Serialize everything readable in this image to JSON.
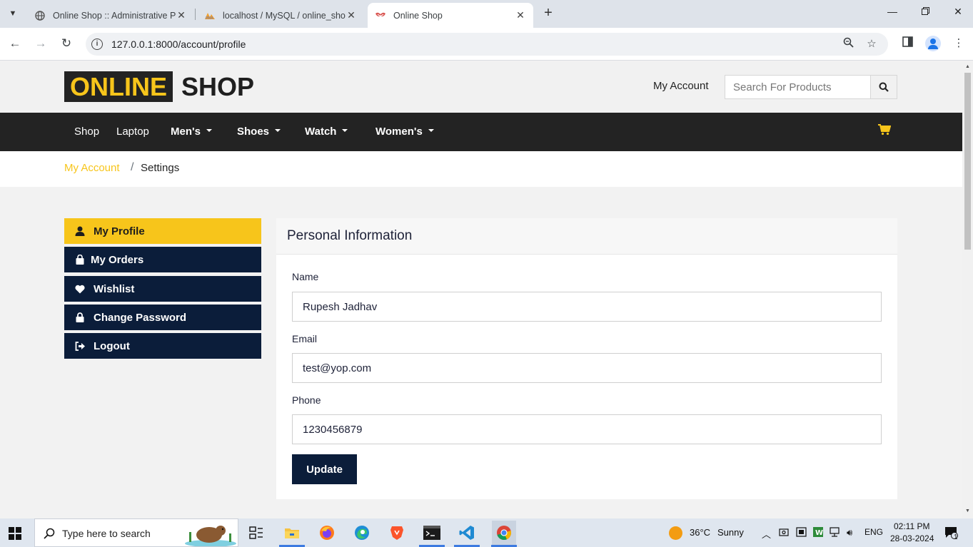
{
  "browser": {
    "tabs": [
      {
        "title": "Online Shop :: Administrative Pa",
        "active": false
      },
      {
        "title": "localhost / MySQL / online_shop",
        "active": false
      },
      {
        "title": "Online Shop",
        "active": true
      }
    ],
    "url": "127.0.0.1:8000/account/profile",
    "new_tab_label": "+",
    "tab_close": "✕"
  },
  "site": {
    "logo_part1": "ONLINE",
    "logo_part2": "SHOP",
    "my_account": "My Account",
    "search_placeholder": "Search For Products",
    "nav": {
      "items": [
        "Shop",
        "Laptop",
        "Men's",
        "Shoes",
        "Watch",
        "Women's"
      ]
    },
    "breadcrumb": {
      "link": "My Account",
      "separator": "/",
      "current": "Settings"
    },
    "sidebar": {
      "items": [
        {
          "label": "My Profile",
          "icon": "user-icon",
          "active": true
        },
        {
          "label": "My Orders",
          "icon": "shopping-bag-icon",
          "active": false
        },
        {
          "label": "Wishlist",
          "icon": "heart-icon",
          "active": false
        },
        {
          "label": "Change Password",
          "icon": "lock-icon",
          "active": false
        },
        {
          "label": "Logout",
          "icon": "sign-out-icon",
          "active": false
        }
      ]
    },
    "profile": {
      "title": "Personal Information",
      "name_label": "Name",
      "name_value": "Rupesh Jadhav",
      "email_label": "Email",
      "email_value": "test@yop.com",
      "phone_label": "Phone",
      "phone_value": "1230456879",
      "update_label": "Update"
    },
    "colors": {
      "accent": "#f7c51b",
      "dark": "#232323",
      "navy": "#0b1d3a"
    }
  },
  "taskbar": {
    "search_placeholder": "Type here to search",
    "weather_temp": "36°C",
    "weather_text": "Sunny",
    "language": "ENG",
    "time": "02:11 PM",
    "date": "28-03-2024",
    "notification_count": "1"
  }
}
